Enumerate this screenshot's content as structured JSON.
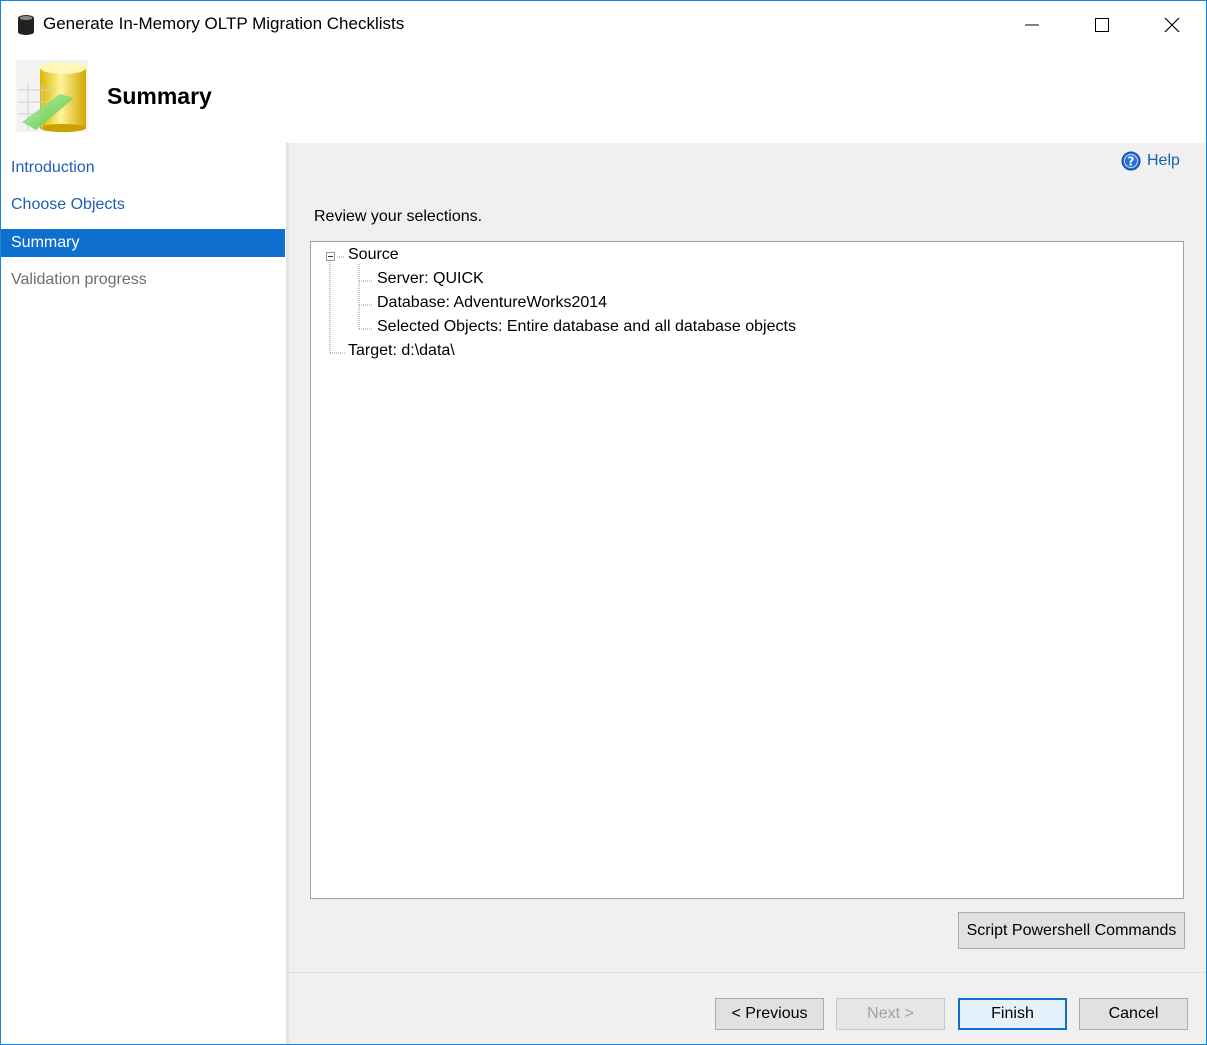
{
  "window": {
    "title": "Generate In-Memory OLTP Migration Checklists",
    "controls": [
      "minimize-icon",
      "maximize-icon",
      "close-icon"
    ]
  },
  "header": {
    "title": "Summary",
    "graphic": "wizard-database-icon"
  },
  "sidebar": {
    "items": [
      {
        "label": "Introduction",
        "state": "link"
      },
      {
        "label": "Choose Objects",
        "state": "link"
      },
      {
        "label": "Summary",
        "state": "active"
      },
      {
        "label": "Validation progress",
        "state": "disabled"
      }
    ]
  },
  "content": {
    "help_label": "Help",
    "help_icon": "help-question-icon",
    "instruction": "Review your selections.",
    "tree": {
      "root": "Source",
      "children": [
        "Server: QUICK",
        "Database: AdventureWorks2014",
        "Selected Objects: Entire database and all database objects"
      ],
      "target": "Target: d:\\data\\"
    },
    "script_button": "Script Powershell Commands"
  },
  "footer": {
    "previous": "< Previous",
    "next": "Next >",
    "finish": "Finish",
    "cancel": "Cancel"
  },
  "colors": {
    "accent": "#0f6fcf",
    "link": "#1c5fb4",
    "panel": "#f0f0f0"
  }
}
